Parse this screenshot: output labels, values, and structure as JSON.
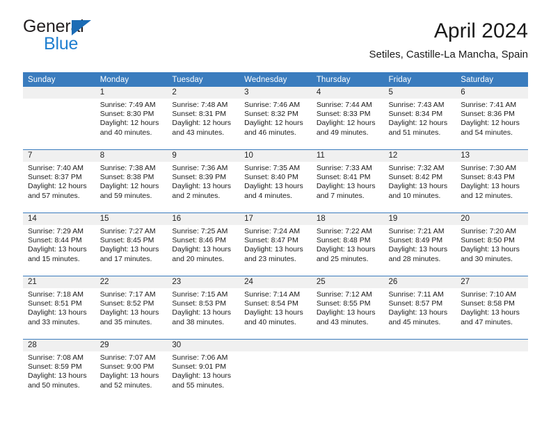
{
  "brand": {
    "word_one": "General",
    "word_two": "Blue",
    "triangle_color": "#1b6cb5",
    "blue_color": "#1f7fd0"
  },
  "header": {
    "title": "April 2024",
    "subtitle": "Setiles, Castille-La Mancha, Spain"
  },
  "theme": {
    "header_row_background": "#3a7cbe",
    "header_row_text": "#ffffff",
    "daynum_background": "#f0f0f0",
    "week_separator": "#3a7cbe",
    "body_text": "#1a1a1a"
  },
  "weekday_headers": [
    "Sunday",
    "Monday",
    "Tuesday",
    "Wednesday",
    "Thursday",
    "Friday",
    "Saturday"
  ],
  "weeks": [
    [
      {
        "day": "",
        "sunrise": "",
        "sunset": "",
        "daylight": ""
      },
      {
        "day": "1",
        "sunrise": "Sunrise: 7:49 AM",
        "sunset": "Sunset: 8:30 PM",
        "daylight": "Daylight: 12 hours and 40 minutes."
      },
      {
        "day": "2",
        "sunrise": "Sunrise: 7:48 AM",
        "sunset": "Sunset: 8:31 PM",
        "daylight": "Daylight: 12 hours and 43 minutes."
      },
      {
        "day": "3",
        "sunrise": "Sunrise: 7:46 AM",
        "sunset": "Sunset: 8:32 PM",
        "daylight": "Daylight: 12 hours and 46 minutes."
      },
      {
        "day": "4",
        "sunrise": "Sunrise: 7:44 AM",
        "sunset": "Sunset: 8:33 PM",
        "daylight": "Daylight: 12 hours and 49 minutes."
      },
      {
        "day": "5",
        "sunrise": "Sunrise: 7:43 AM",
        "sunset": "Sunset: 8:34 PM",
        "daylight": "Daylight: 12 hours and 51 minutes."
      },
      {
        "day": "6",
        "sunrise": "Sunrise: 7:41 AM",
        "sunset": "Sunset: 8:36 PM",
        "daylight": "Daylight: 12 hours and 54 minutes."
      }
    ],
    [
      {
        "day": "7",
        "sunrise": "Sunrise: 7:40 AM",
        "sunset": "Sunset: 8:37 PM",
        "daylight": "Daylight: 12 hours and 57 minutes."
      },
      {
        "day": "8",
        "sunrise": "Sunrise: 7:38 AM",
        "sunset": "Sunset: 8:38 PM",
        "daylight": "Daylight: 12 hours and 59 minutes."
      },
      {
        "day": "9",
        "sunrise": "Sunrise: 7:36 AM",
        "sunset": "Sunset: 8:39 PM",
        "daylight": "Daylight: 13 hours and 2 minutes."
      },
      {
        "day": "10",
        "sunrise": "Sunrise: 7:35 AM",
        "sunset": "Sunset: 8:40 PM",
        "daylight": "Daylight: 13 hours and 4 minutes."
      },
      {
        "day": "11",
        "sunrise": "Sunrise: 7:33 AM",
        "sunset": "Sunset: 8:41 PM",
        "daylight": "Daylight: 13 hours and 7 minutes."
      },
      {
        "day": "12",
        "sunrise": "Sunrise: 7:32 AM",
        "sunset": "Sunset: 8:42 PM",
        "daylight": "Daylight: 13 hours and 10 minutes."
      },
      {
        "day": "13",
        "sunrise": "Sunrise: 7:30 AM",
        "sunset": "Sunset: 8:43 PM",
        "daylight": "Daylight: 13 hours and 12 minutes."
      }
    ],
    [
      {
        "day": "14",
        "sunrise": "Sunrise: 7:29 AM",
        "sunset": "Sunset: 8:44 PM",
        "daylight": "Daylight: 13 hours and 15 minutes."
      },
      {
        "day": "15",
        "sunrise": "Sunrise: 7:27 AM",
        "sunset": "Sunset: 8:45 PM",
        "daylight": "Daylight: 13 hours and 17 minutes."
      },
      {
        "day": "16",
        "sunrise": "Sunrise: 7:25 AM",
        "sunset": "Sunset: 8:46 PM",
        "daylight": "Daylight: 13 hours and 20 minutes."
      },
      {
        "day": "17",
        "sunrise": "Sunrise: 7:24 AM",
        "sunset": "Sunset: 8:47 PM",
        "daylight": "Daylight: 13 hours and 23 minutes."
      },
      {
        "day": "18",
        "sunrise": "Sunrise: 7:22 AM",
        "sunset": "Sunset: 8:48 PM",
        "daylight": "Daylight: 13 hours and 25 minutes."
      },
      {
        "day": "19",
        "sunrise": "Sunrise: 7:21 AM",
        "sunset": "Sunset: 8:49 PM",
        "daylight": "Daylight: 13 hours and 28 minutes."
      },
      {
        "day": "20",
        "sunrise": "Sunrise: 7:20 AM",
        "sunset": "Sunset: 8:50 PM",
        "daylight": "Daylight: 13 hours and 30 minutes."
      }
    ],
    [
      {
        "day": "21",
        "sunrise": "Sunrise: 7:18 AM",
        "sunset": "Sunset: 8:51 PM",
        "daylight": "Daylight: 13 hours and 33 minutes."
      },
      {
        "day": "22",
        "sunrise": "Sunrise: 7:17 AM",
        "sunset": "Sunset: 8:52 PM",
        "daylight": "Daylight: 13 hours and 35 minutes."
      },
      {
        "day": "23",
        "sunrise": "Sunrise: 7:15 AM",
        "sunset": "Sunset: 8:53 PM",
        "daylight": "Daylight: 13 hours and 38 minutes."
      },
      {
        "day": "24",
        "sunrise": "Sunrise: 7:14 AM",
        "sunset": "Sunset: 8:54 PM",
        "daylight": "Daylight: 13 hours and 40 minutes."
      },
      {
        "day": "25",
        "sunrise": "Sunrise: 7:12 AM",
        "sunset": "Sunset: 8:55 PM",
        "daylight": "Daylight: 13 hours and 43 minutes."
      },
      {
        "day": "26",
        "sunrise": "Sunrise: 7:11 AM",
        "sunset": "Sunset: 8:57 PM",
        "daylight": "Daylight: 13 hours and 45 minutes."
      },
      {
        "day": "27",
        "sunrise": "Sunrise: 7:10 AM",
        "sunset": "Sunset: 8:58 PM",
        "daylight": "Daylight: 13 hours and 47 minutes."
      }
    ],
    [
      {
        "day": "28",
        "sunrise": "Sunrise: 7:08 AM",
        "sunset": "Sunset: 8:59 PM",
        "daylight": "Daylight: 13 hours and 50 minutes."
      },
      {
        "day": "29",
        "sunrise": "Sunrise: 7:07 AM",
        "sunset": "Sunset: 9:00 PM",
        "daylight": "Daylight: 13 hours and 52 minutes."
      },
      {
        "day": "30",
        "sunrise": "Sunrise: 7:06 AM",
        "sunset": "Sunset: 9:01 PM",
        "daylight": "Daylight: 13 hours and 55 minutes."
      },
      {
        "day": "",
        "sunrise": "",
        "sunset": "",
        "daylight": ""
      },
      {
        "day": "",
        "sunrise": "",
        "sunset": "",
        "daylight": ""
      },
      {
        "day": "",
        "sunrise": "",
        "sunset": "",
        "daylight": ""
      },
      {
        "day": "",
        "sunrise": "",
        "sunset": "",
        "daylight": ""
      }
    ]
  ]
}
